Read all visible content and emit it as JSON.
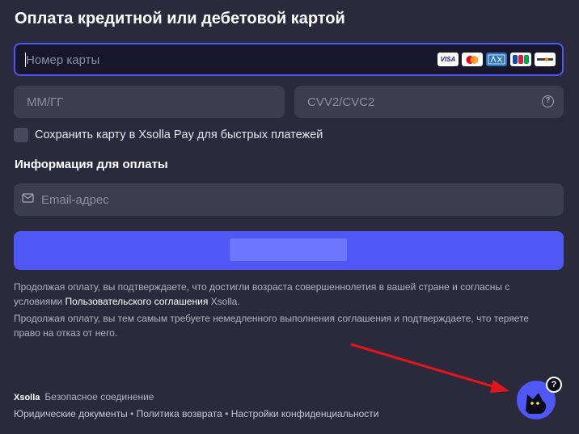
{
  "title": "Оплата кредитной или дебетовой картой",
  "card": {
    "placeholder": "Номер карты",
    "brands": [
      "VISA",
      "MC",
      "AMEX",
      "JCB",
      "DISCOVER"
    ]
  },
  "expiry": {
    "placeholder": "ММ/ГГ"
  },
  "cvv": {
    "placeholder": "CVV2/CVC2",
    "help": "?"
  },
  "save_card": {
    "label": "Сохранить карту в Xsolla Pay для быстрых платежей"
  },
  "billing": {
    "title": "Информация для оплаты",
    "email_placeholder": "Email-адрес"
  },
  "pay_button": {
    "label": ""
  },
  "legal": {
    "p1_before": "Продолжая оплату, вы подтверждаете, что достигли возраста совершеннолетия в вашей стране и согласны с условиями ",
    "p1_link": "Пользовательского соглашения",
    "p1_after": " Xsolla.",
    "p2": "Продолжая оплату, вы тем самым требуете немедленного выполнения соглашения и подтверждаете, что теряете право на отказ от него."
  },
  "footer": {
    "brand": "Xsolla",
    "secure": "Безопасное соединение",
    "links": [
      "Юридические документы",
      "Политика возврата",
      "Настройки конфиденциальности"
    ],
    "separator": "•"
  },
  "support": {
    "badge": "?"
  },
  "colors": {
    "accent": "#4f57f5",
    "background": "#2b2a3d",
    "field": "#3e3d4f",
    "annotation_arrow": "#e0161b"
  }
}
